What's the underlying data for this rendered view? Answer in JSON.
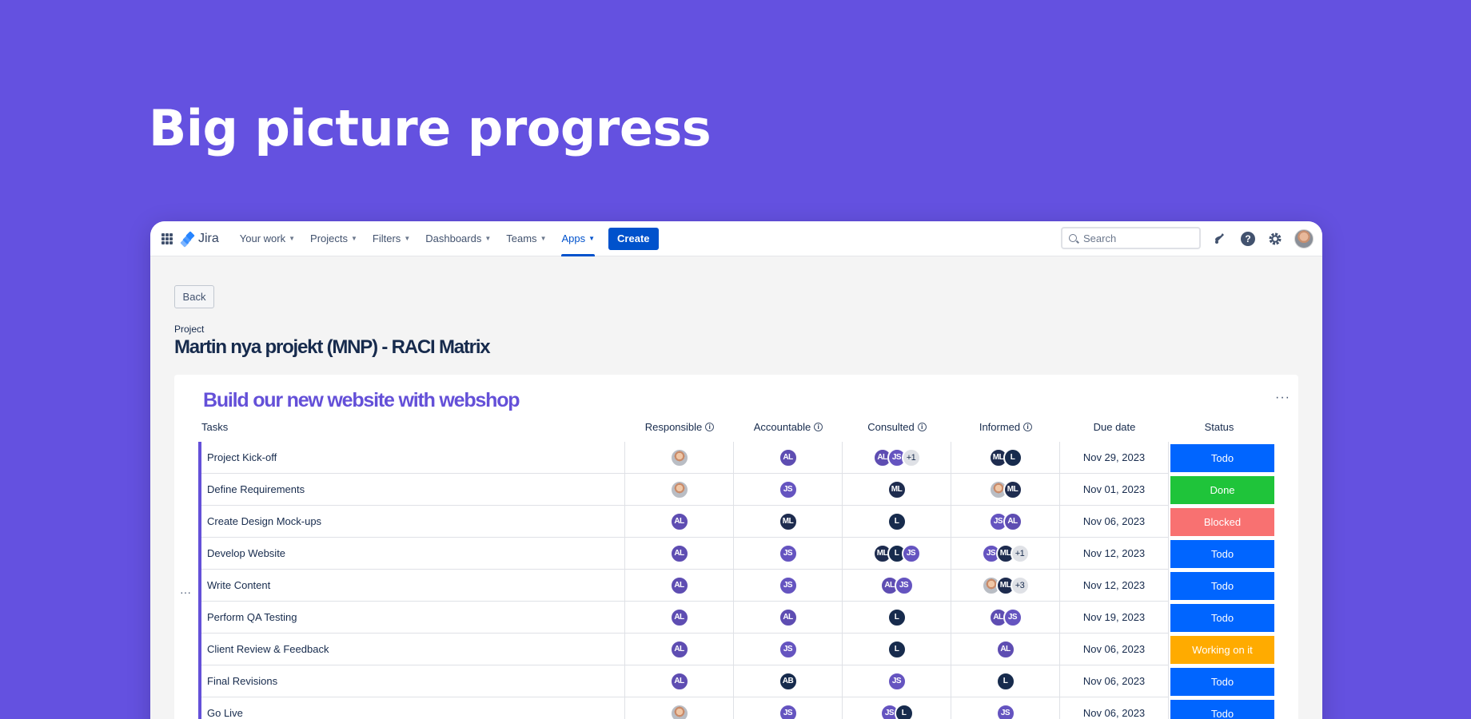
{
  "hero": {
    "title": "Big picture progress"
  },
  "colors": {
    "background": "#6451e0",
    "brand": "#0052cc",
    "accent": "#6450d8",
    "status_todo": "#0065ff",
    "status_done": "#1fc43a",
    "status_blocked": "#f87171",
    "status_working": "#ffab00",
    "avatar_AL": "#5e4db2",
    "avatar_JS": "#6554c0",
    "avatar_ML": "#1e2c4f",
    "avatar_L": "#172b4d",
    "avatar_AB": "#172b4d"
  },
  "nav": {
    "logo": "Jira",
    "items": [
      {
        "label": "Your work",
        "active": false
      },
      {
        "label": "Projects",
        "active": false
      },
      {
        "label": "Filters",
        "active": false
      },
      {
        "label": "Dashboards",
        "active": false
      },
      {
        "label": "Teams",
        "active": false
      },
      {
        "label": "Apps",
        "active": true
      }
    ],
    "create_label": "Create",
    "search_placeholder": "Search",
    "icons": [
      "notification-icon",
      "help-icon",
      "settings-icon",
      "profile-avatar"
    ]
  },
  "page": {
    "back_label": "Back",
    "project_label": "Project",
    "project_title": "Martin nya projekt (MNP) - RACI Matrix"
  },
  "card": {
    "title": "Build our new website with webshop",
    "columns": {
      "tasks": "Tasks",
      "responsible": "Responsible",
      "accountable": "Accountable",
      "consulted": "Consulted",
      "informed": "Informed",
      "due": "Due date",
      "status": "Status"
    },
    "rows": [
      {
        "task": "Project Kick-off",
        "responsible": [
          "photo"
        ],
        "accountable": [
          "AL"
        ],
        "consulted": [
          "AL",
          "JS",
          "+1"
        ],
        "informed": [
          "ML",
          "L"
        ],
        "due": "Nov 29, 2023",
        "status": "Todo",
        "status_color": "#0065ff"
      },
      {
        "task": "Define Requirements",
        "responsible": [
          "photo"
        ],
        "accountable": [
          "JS"
        ],
        "consulted": [
          "ML"
        ],
        "informed": [
          "photo",
          "ML"
        ],
        "due": "Nov 01, 2023",
        "status": "Done",
        "status_color": "#1fc43a"
      },
      {
        "task": "Create Design Mock-ups",
        "responsible": [
          "AL"
        ],
        "accountable": [
          "ML"
        ],
        "consulted": [
          "L"
        ],
        "informed": [
          "JS",
          "AL"
        ],
        "due": "Nov 06, 2023",
        "status": "Blocked",
        "status_color": "#f87171"
      },
      {
        "task": "Develop Website",
        "responsible": [
          "AL"
        ],
        "accountable": [
          "JS"
        ],
        "consulted": [
          "ML",
          "L",
          "JS"
        ],
        "informed": [
          "JS",
          "ML",
          "+1"
        ],
        "due": "Nov 12, 2023",
        "status": "Todo",
        "status_color": "#0065ff"
      },
      {
        "task": "Write Content",
        "responsible": [
          "AL"
        ],
        "accountable": [
          "JS"
        ],
        "consulted": [
          "AL",
          "JS"
        ],
        "informed": [
          "photo",
          "ML",
          "+3"
        ],
        "due": "Nov 12, 2023",
        "status": "Todo",
        "status_color": "#0065ff"
      },
      {
        "task": "Perform QA Testing",
        "responsible": [
          "AL"
        ],
        "accountable": [
          "AL"
        ],
        "consulted": [
          "L"
        ],
        "informed": [
          "AL",
          "JS"
        ],
        "due": "Nov 19, 2023",
        "status": "Todo",
        "status_color": "#0065ff"
      },
      {
        "task": "Client Review & Feedback",
        "responsible": [
          "AL"
        ],
        "accountable": [
          "JS"
        ],
        "consulted": [
          "L"
        ],
        "informed": [
          "AL"
        ],
        "due": "Nov 06, 2023",
        "status": "Working on it",
        "status_color": "#ffab00"
      },
      {
        "task": "Final Revisions",
        "responsible": [
          "AL"
        ],
        "accountable": [
          "AB"
        ],
        "consulted": [
          "JS"
        ],
        "informed": [
          "L"
        ],
        "due": "Nov 06, 2023",
        "status": "Todo",
        "status_color": "#0065ff"
      },
      {
        "task": "Go Live",
        "responsible": [
          "photo"
        ],
        "accountable": [
          "JS"
        ],
        "consulted": [
          "JS",
          "L"
        ],
        "informed": [
          "JS"
        ],
        "due": "Nov 06, 2023",
        "status": "Todo",
        "status_color": "#0065ff"
      }
    ]
  }
}
